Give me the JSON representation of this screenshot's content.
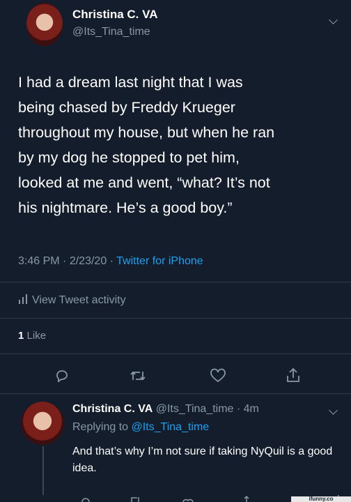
{
  "tweet": {
    "author_name": "Christina C. VA",
    "author_handle": "@Its_Tina_time",
    "text_lines": [
      "I had a dream last night that I was",
      "being chased by Freddy Krueger",
      "throughout my house, but when he ran",
      "by my dog he stopped to pet him,",
      "looked at me and went, “what? It’s not",
      "his nightmare. He’s a good boy.”"
    ],
    "time": "3:46 PM",
    "date": "2/23/20",
    "source": "Twitter for iPhone",
    "separator": "·",
    "activity_label": "View Tweet activity",
    "likes_count": "1",
    "likes_label": "Like"
  },
  "reply": {
    "author_name": "Christina C. VA",
    "author_handle": "@Its_Tina_time",
    "age": "4m",
    "replying_prefix": "Replying to",
    "replying_handle": "@Its_Tina_time",
    "text": "And that’s why I’m not sure if taking NyQuil is a good idea."
  },
  "watermark": "ifunny.co",
  "colors": {
    "background": "#141d2b",
    "muted": "#8899a6",
    "link": "#1da1f2",
    "text": "#ffffff"
  },
  "icons": [
    "avatar",
    "chevron-down-icon",
    "chart-icon",
    "reply-icon",
    "retweet-icon",
    "like-icon",
    "share-icon"
  ]
}
